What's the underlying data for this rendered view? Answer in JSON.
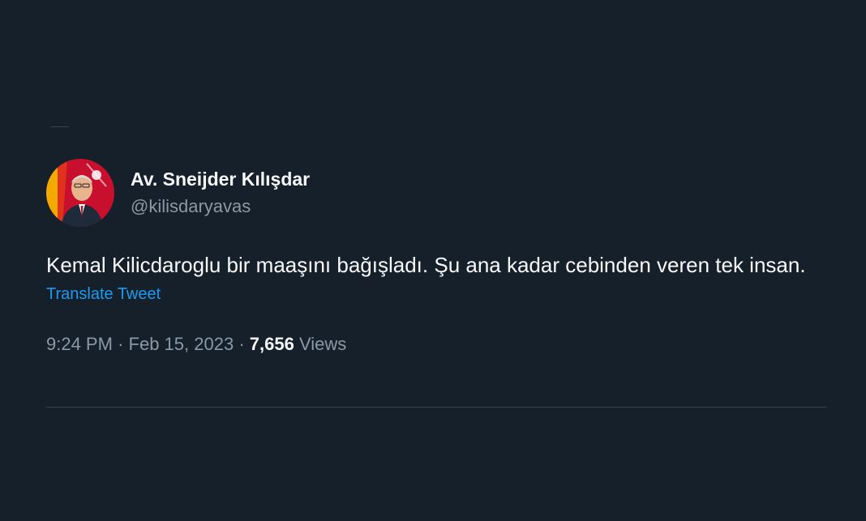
{
  "tweet": {
    "author": {
      "display_name": "Av. Sneijder Kılışdar",
      "handle": "@kilisdaryavas"
    },
    "text": "Kemal Kilicdaroglu bir maaşını bağışladı. Şu ana kadar cebinden veren tek insan.",
    "translate_label": "Translate Tweet",
    "time": "9:24 PM",
    "separator": "·",
    "date": "Feb 15, 2023",
    "views_count": "7,656",
    "views_label": "Views"
  },
  "colors": {
    "background": "#15202b",
    "text_primary": "#f7f9f9",
    "text_secondary": "#8b98a5",
    "link": "#1d9bf0",
    "divider": "#38444d"
  }
}
